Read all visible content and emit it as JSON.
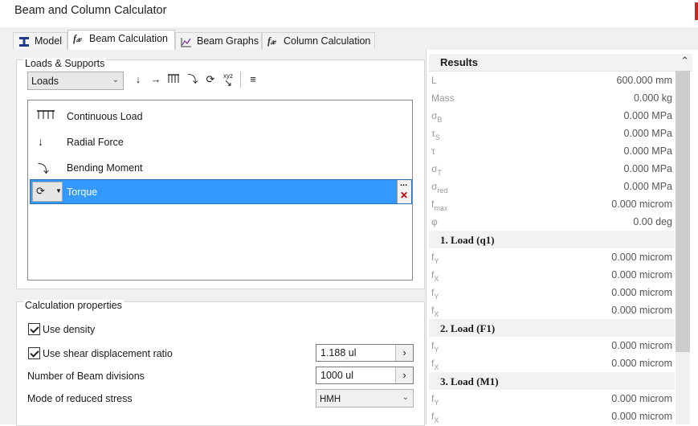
{
  "window": {
    "title": "Beam and Column Calculator"
  },
  "tabs": [
    {
      "label": "Model",
      "icon": "beam-icon"
    },
    {
      "label": "Beam Calculation",
      "icon": "formula-icon"
    },
    {
      "label": "Beam Graphs",
      "icon": "graph-icon"
    },
    {
      "label": "Column Calculation",
      "icon": "formula-icon"
    }
  ],
  "active_tab": "Beam Calculation",
  "loads_group": {
    "title": "Loads & Supports",
    "combo_value": "Loads",
    "toolbar": [
      "radial-force-icon",
      "axial-force-icon",
      "continuous-load-icon",
      "bending-moment-icon",
      "torque-icon",
      "xyz-load-icon",
      "list-icon"
    ],
    "items": [
      {
        "label": "Continuous Load",
        "icon": "continuous-load-icon"
      },
      {
        "label": "Radial Force",
        "icon": "radial-force-icon"
      },
      {
        "label": "Bending Moment",
        "icon": "bending-moment-icon"
      },
      {
        "label": "Torque",
        "icon": "torque-icon",
        "selected": true
      }
    ],
    "item_more": "...",
    "item_delete": "✕"
  },
  "calc_group": {
    "title": "Calculation properties",
    "use_density": {
      "label": "Use density",
      "checked": true
    },
    "use_shear": {
      "label": "Use shear displacement ratio",
      "checked": true,
      "value": "1.188 ul"
    },
    "beam_divisions": {
      "label": "Number of Beam divisions",
      "value": "1000 ul"
    },
    "reduced_stress": {
      "label": "Mode of reduced stress",
      "value": "HMH"
    }
  },
  "results": {
    "title": "Results",
    "rows": [
      {
        "k": "L",
        "sub": "",
        "v": "600.000 mm"
      },
      {
        "k": "Mass",
        "sub": "",
        "v": "0.000 kg"
      },
      {
        "k": "σ",
        "sub": "B",
        "v": "0.000 MPa"
      },
      {
        "k": "τ",
        "sub": "S",
        "v": "0.000 MPa"
      },
      {
        "k": "τ",
        "sub": "",
        "v": "0.000 MPa"
      },
      {
        "k": "σ",
        "sub": "T",
        "v": "0.000 MPa"
      },
      {
        "k": "σ",
        "sub": "red",
        "v": "0.000 MPa"
      },
      {
        "k": "f",
        "sub": "max",
        "v": "0.000 microm"
      },
      {
        "k": "φ",
        "sub": "",
        "v": "0.00 deg"
      }
    ],
    "sections": [
      {
        "title": "1. Load (q1)",
        "rows": [
          {
            "k": "f",
            "sub": "Y",
            "v": "0.000 microm"
          },
          {
            "k": "f",
            "sub": "X",
            "v": "0.000 microm"
          },
          {
            "k": "f",
            "sub": "Y",
            "v": "0.000 microm"
          },
          {
            "k": "f",
            "sub": "X",
            "v": "0.000 microm"
          }
        ]
      },
      {
        "title": "2. Load (F1)",
        "rows": [
          {
            "k": "f",
            "sub": "Y",
            "v": "0.000 microm"
          },
          {
            "k": "f",
            "sub": "X",
            "v": "0.000 microm"
          }
        ]
      },
      {
        "title": "3. Load (M1)",
        "rows": [
          {
            "k": "f",
            "sub": "Y",
            "v": "0.000 microm"
          },
          {
            "k": "f",
            "sub": "X",
            "v": "0.000 microm"
          }
        ]
      }
    ]
  }
}
